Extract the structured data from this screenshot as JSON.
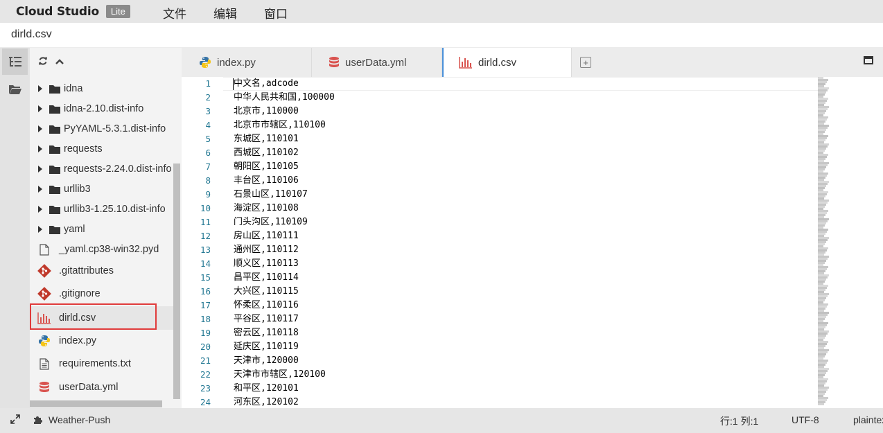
{
  "app": {
    "name": "Cloud Studio",
    "badge": "Lite",
    "menu": [
      "文件",
      "编辑",
      "窗口"
    ]
  },
  "breadcrumb": "dirld.csv",
  "sidebar": {
    "items": [
      {
        "label": "idna",
        "type": "folder"
      },
      {
        "label": "idna-2.10.dist-info",
        "type": "folder"
      },
      {
        "label": "PyYAML-5.3.1.dist-info",
        "type": "folder"
      },
      {
        "label": "requests",
        "type": "folder"
      },
      {
        "label": "requests-2.24.0.dist-info",
        "type": "folder"
      },
      {
        "label": "urllib3",
        "type": "folder"
      },
      {
        "label": "urllib3-1.25.10.dist-info",
        "type": "folder"
      },
      {
        "label": "yaml",
        "type": "folder"
      },
      {
        "label": "_yaml.cp38-win32.pyd",
        "type": "file",
        "icon": "file-icon"
      },
      {
        "label": ".gitattributes",
        "type": "file",
        "icon": "git-icon"
      },
      {
        "label": ".gitignore",
        "type": "file",
        "icon": "git-icon"
      },
      {
        "label": "dirld.csv",
        "type": "file",
        "icon": "csv-chart-icon",
        "selected": true
      },
      {
        "label": "index.py",
        "type": "file",
        "icon": "python-icon"
      },
      {
        "label": "requirements.txt",
        "type": "file",
        "icon": "text-file-icon"
      },
      {
        "label": "userData.yml",
        "type": "file",
        "icon": "database-icon"
      }
    ]
  },
  "tabs": [
    {
      "label": "index.py",
      "icon": "python-icon"
    },
    {
      "label": "userData.yml",
      "icon": "database-icon"
    },
    {
      "label": "dirld.csv",
      "icon": "csv-chart-icon",
      "active": true
    }
  ],
  "editor": {
    "lines": [
      "中文名,adcode",
      "中华人民共和国,100000",
      "北京市,110000",
      "北京市市辖区,110100",
      "东城区,110101",
      "西城区,110102",
      "朝阳区,110105",
      "丰台区,110106",
      "石景山区,110107",
      "海淀区,110108",
      "门头沟区,110109",
      "房山区,110111",
      "通州区,110112",
      "顺义区,110113",
      "昌平区,110114",
      "大兴区,110115",
      "怀柔区,110116",
      "平谷区,110117",
      "密云区,110118",
      "延庆区,110119",
      "天津市,120000",
      "天津市市辖区,120100",
      "和平区,120101",
      "河东区,120102"
    ],
    "line_numbers": [
      "1",
      "2",
      "3",
      "4",
      "5",
      "6",
      "7",
      "8",
      "9",
      "10",
      "11",
      "12",
      "13",
      "14",
      "15",
      "16",
      "17",
      "18",
      "19",
      "20",
      "21",
      "22",
      "23",
      "24"
    ]
  },
  "statusbar": {
    "project": "Weather-Push",
    "position": "行:1 列:1",
    "encoding": "UTF-8",
    "language": "plaintext"
  },
  "colors": {
    "accent": "#4a90d9",
    "selection_border": "#e03b3b",
    "git": "#c0392b",
    "python_blue": "#3572a5",
    "python_yellow": "#f5c518",
    "csv_icon": "#d9534f",
    "line_number": "#237893"
  }
}
